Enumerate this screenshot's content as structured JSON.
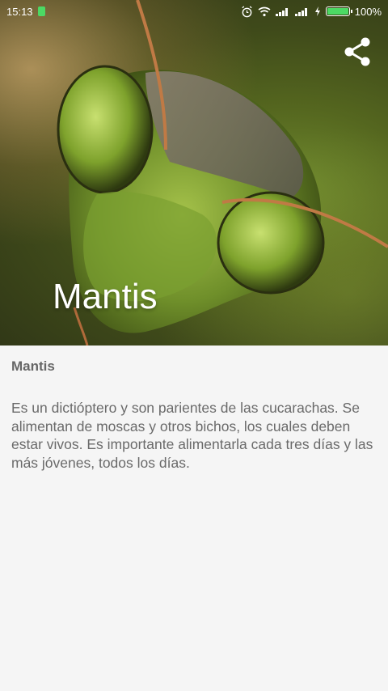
{
  "status": {
    "time": "15:13",
    "battery": "100%",
    "battery_level": 100,
    "icons": [
      "battery-saver-icon",
      "alarm-icon",
      "wifi-icon",
      "signal-icon",
      "signal-icon",
      "charging-icon",
      "battery-icon"
    ]
  },
  "header": {
    "title": "Mantis",
    "share_icon": "share-icon"
  },
  "article": {
    "heading": "Mantis",
    "body": "Es un dictióptero y son parientes de las cucarachas. Se alimentan de moscas y otros bichos, los cuales deben estar vivos. Es importante alimentarla cada tres días y las más jóvenes, todos los días."
  },
  "colors": {
    "battery": "#4cd964",
    "background": "#f5f5f5",
    "text": "#666666"
  }
}
